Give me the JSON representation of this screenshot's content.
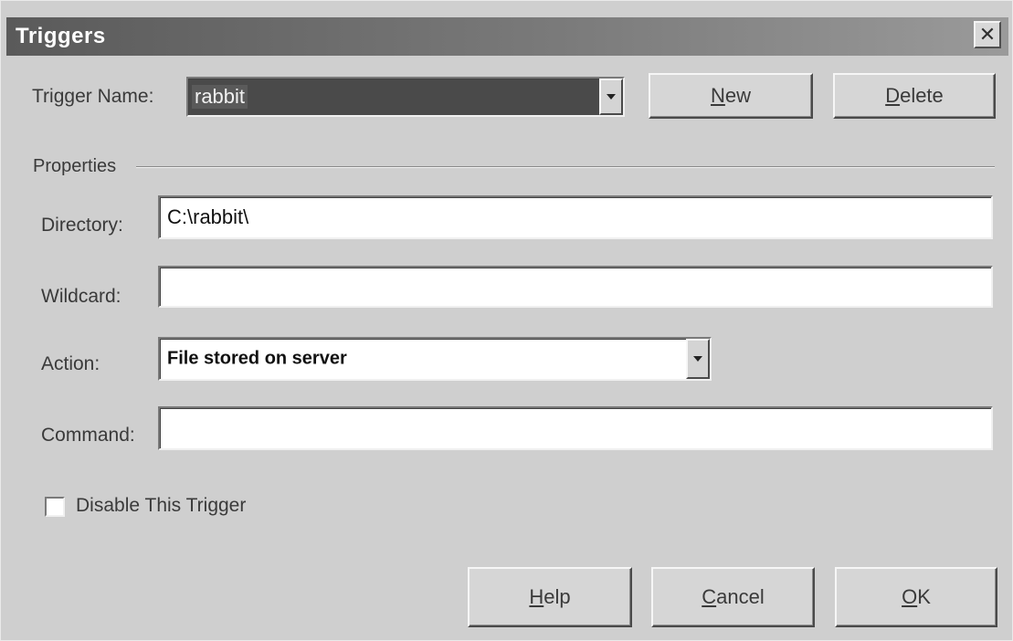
{
  "window": {
    "title": "Triggers",
    "close_glyph": "✕"
  },
  "trigger_name": {
    "label": "Trigger Name:",
    "value": "rabbit"
  },
  "buttons": {
    "new": "New",
    "delete": "Delete",
    "help": "Help",
    "cancel": "Cancel",
    "ok": "OK"
  },
  "properties": {
    "group_label": "Properties",
    "directory": {
      "label": "Directory:",
      "value": "C:\\rabbit\\"
    },
    "wildcard": {
      "label": "Wildcard:",
      "value": ""
    },
    "action": {
      "label": "Action:",
      "value": "File stored on server"
    },
    "command": {
      "label": "Command:",
      "value": ""
    }
  },
  "disable_trigger": {
    "label": "Disable This Trigger",
    "checked": false
  },
  "icons": {
    "close": "close-icon",
    "dropdown": "chevron-down-icon"
  }
}
